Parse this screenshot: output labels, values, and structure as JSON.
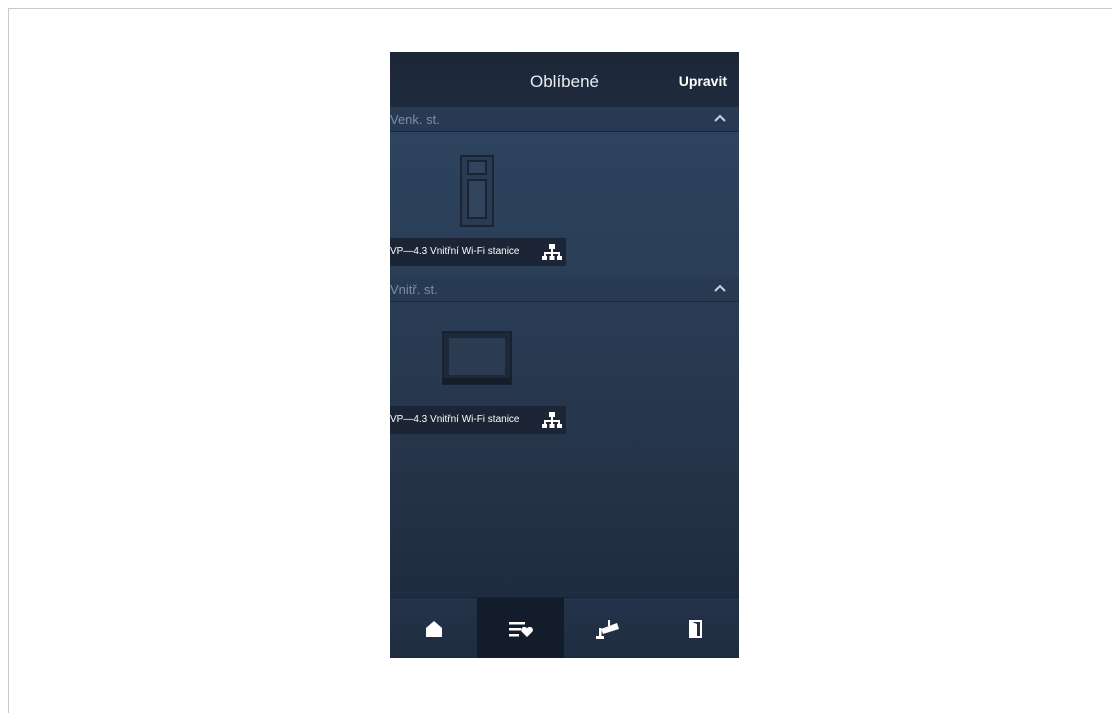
{
  "header": {
    "title": "Oblíbené",
    "edit_label": "Upravit"
  },
  "sections": [
    {
      "title": "Venk. st.",
      "device_label": "VP—4.3 Vnitřní Wi-Fi stanice",
      "device_icon": "outdoor-station-icon",
      "network_icon": "network-icon"
    },
    {
      "title": "Vnitř. st.",
      "device_label": "VP—4.3 Vnitřní Wi-Fi stanice",
      "device_icon": "indoor-monitor-icon",
      "network_icon": "network-icon"
    }
  ],
  "bottom_nav": [
    {
      "name": "home",
      "icon": "home-icon",
      "active": false
    },
    {
      "name": "favorites",
      "icon": "favorites-list-icon",
      "active": true
    },
    {
      "name": "camera",
      "icon": "camera-icon",
      "active": false
    },
    {
      "name": "door",
      "icon": "door-icon",
      "active": false
    }
  ],
  "colors": {
    "background": "#2a3d55",
    "header": "#1c2637",
    "active_tab": "#121c2b",
    "section_text": "#7c8ea6"
  }
}
